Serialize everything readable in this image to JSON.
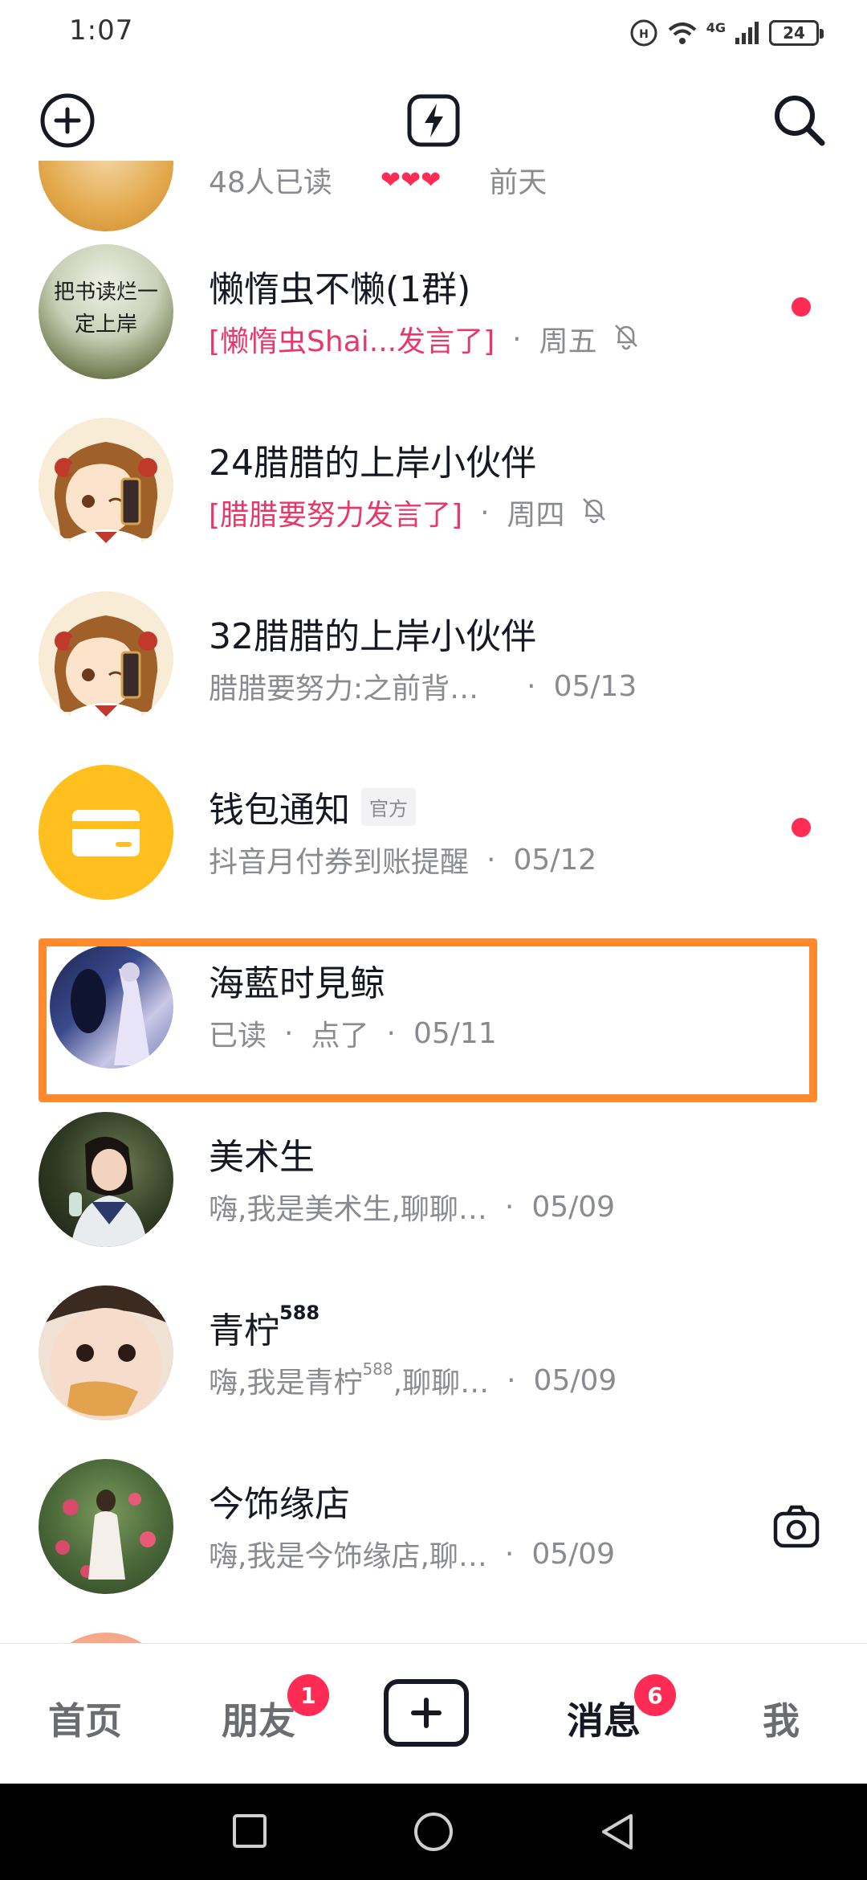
{
  "status_bar": {
    "time": "1:07",
    "network": "4G",
    "battery": "24"
  },
  "partial_row": {
    "sub": "48人已读",
    "time": "前天"
  },
  "conversations": [
    {
      "name": "懒惰虫不懒(1群)",
      "sub": "[懒惰虫Shai...发言了]",
      "time": "周五",
      "sub_highlight": true,
      "muted": true,
      "unread": true
    },
    {
      "name": "24腊腊的上岸小伙伴",
      "sub": "[腊腊要努力发言了]",
      "time": "周四",
      "sub_highlight": true,
      "muted": true,
      "unread": false
    },
    {
      "name": "32腊腊的上岸小伙伴",
      "sub": "腊腊要努力:之前背…",
      "time": "05/13",
      "sub_highlight": false,
      "muted": false,
      "unread": false
    },
    {
      "name": "钱包通知",
      "badge": "官方",
      "sub": "抖音月付券到账提醒",
      "time": "05/12",
      "sub_highlight": false,
      "muted": false,
      "unread": true
    },
    {
      "name": "海藍时見鲸",
      "sub": "已读",
      "sub2": "点了",
      "time": "05/11",
      "sub_highlight": false,
      "muted": false,
      "unread": false
    },
    {
      "name": "美术生",
      "sub": "嗨,我是美术生,聊聊…",
      "time": "05/09",
      "sub_highlight": false,
      "muted": false,
      "unread": false
    },
    {
      "name": "青柠",
      "name_sup": "588",
      "sub": "嗨,我是青柠",
      "sub_sup": "588",
      "sub_tail": ",聊聊…",
      "time": "05/09",
      "sub_highlight": false,
      "muted": false,
      "unread": false
    },
    {
      "name": "今饰缘店",
      "sub": "嗨,我是今饰缘店,聊…",
      "time": "05/09",
      "sub_highlight": false,
      "muted": false,
      "unread": false,
      "camera": true
    }
  ],
  "avatar_text": {
    "row0": "把书读烂一定上岸"
  },
  "bottom_nav": {
    "home": "首页",
    "friends": "朋友",
    "friends_badge": "1",
    "messages": "消息",
    "messages_badge": "6",
    "me": "我"
  },
  "colors": {
    "accent": "#fe2c55",
    "highlight": "#e8386a",
    "annotation_box": "#ff8a2d"
  },
  "icons": {
    "top_left": "add-circle-icon",
    "top_center": "flash-icon",
    "top_right": "search-icon"
  }
}
